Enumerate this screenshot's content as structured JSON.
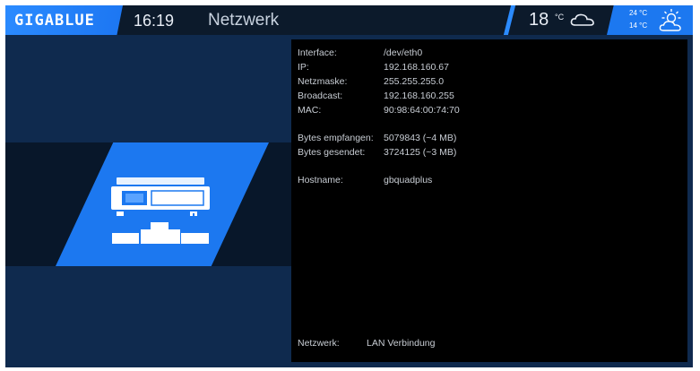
{
  "header": {
    "logo": "GIGABLUE",
    "time": "16:19",
    "title": "Netzwerk",
    "weather": {
      "temperature": "18",
      "unit": "°C",
      "condition_icon": "cloud-icon",
      "forecast_high": "24 °C",
      "forecast_low": "14 °C",
      "forecast_icon": "sun-cloud-icon"
    }
  },
  "info": {
    "interface": {
      "label": "Interface:",
      "value": "/dev/eth0"
    },
    "ip": {
      "label": "IP:",
      "value": "192.168.160.67"
    },
    "netmask": {
      "label": "Netzmaske:",
      "value": "255.255.255.0"
    },
    "broadcast": {
      "label": "Broadcast:",
      "value": "192.168.160.255"
    },
    "mac": {
      "label": "MAC:",
      "value": "90:98:64:00:74:70"
    },
    "bytes_received": {
      "label": "Bytes empfangen:",
      "value": "5079843  (~4 MB)"
    },
    "bytes_sent": {
      "label": "Bytes gesendet:",
      "value": "3724125  (~3 MB)"
    },
    "hostname": {
      "label": "Hostname:",
      "value": "gbquadplus"
    },
    "network": {
      "label": "Netzwerk:",
      "value": "LAN Verbindung"
    }
  },
  "colors": {
    "accent": "#1c78f0",
    "background": "#0f2a4e",
    "topbar": "#0c1a2b",
    "panel": "#000000"
  }
}
